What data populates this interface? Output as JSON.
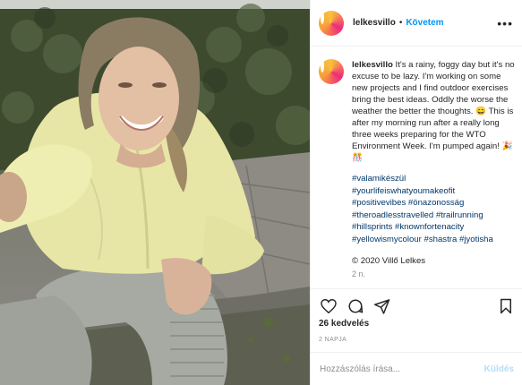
{
  "post": {
    "username": "lelkesvillo",
    "follow_label": "Követem",
    "separator": "•",
    "more_label": "•••",
    "caption_text": "It's a rainy, foggy day but it's no excuse to be lazy. I'm working on some new projects and I find outdoor exercises bring the best ideas. Oddly the worse the weather the better the thoughts. 😄 This is after my morning run after a really long three weeks preparing for the WTO Environment Week. I'm pumped again! 🎉🎊",
    "hashtags": [
      "#valamikészül",
      "#yourlifeiswhatyoumakeofit",
      "#positivevibes #önazonosság",
      "#theroadlesstravelled #trailrunning",
      "#hillsprints #knownfortenacity",
      "#yellowismycolour #shastra #jyotisha"
    ],
    "copyright": "© 2020 Villő Lelkes",
    "comment_age": "2 n.",
    "likes": "26 kedvelés",
    "date": "2 NAPJA",
    "comment_placeholder": "Hozzászólás írása...",
    "send_label": "Küldés"
  },
  "icons": {
    "like": "heart-icon",
    "comment": "comment-icon",
    "share": "send-icon",
    "save": "bookmark-icon"
  }
}
